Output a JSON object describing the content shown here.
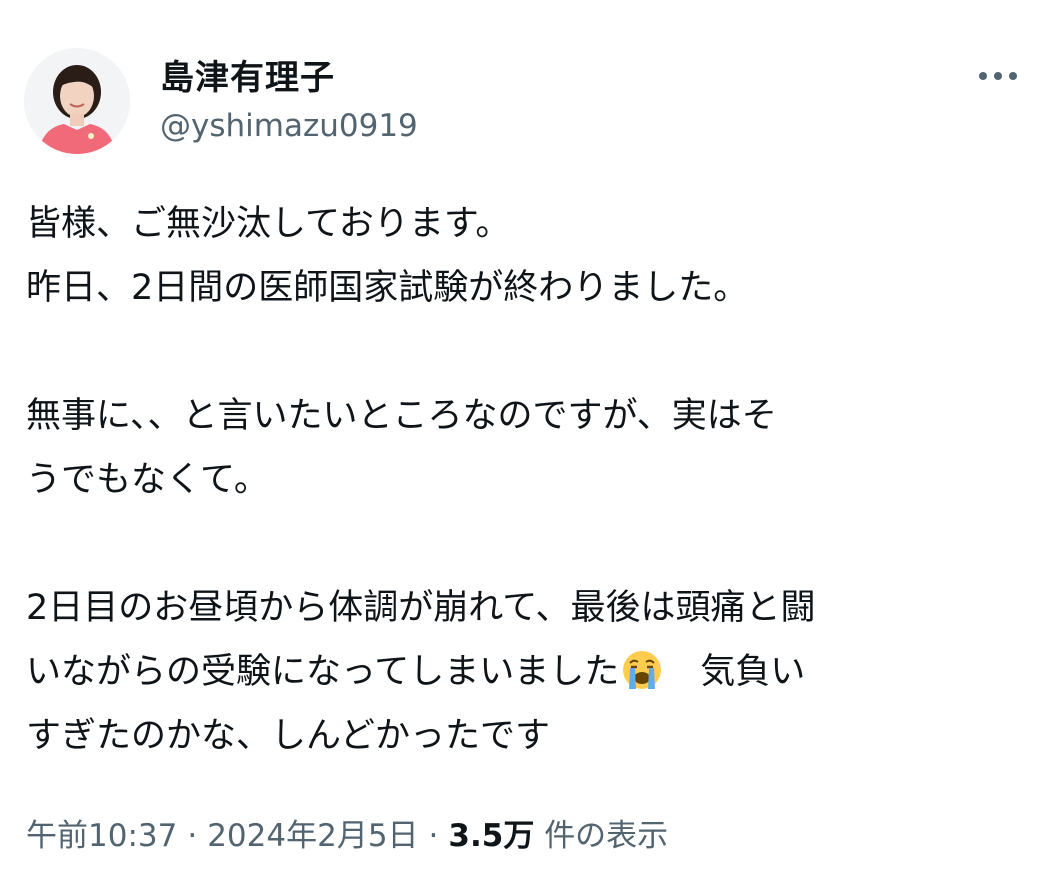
{
  "author": {
    "display_name": "島津有理子",
    "handle": "@yshimazu0919",
    "avatar_icon": "profile-photo"
  },
  "more_menu_icon": "more-horizontal-icon",
  "tweet": {
    "lines": [
      "皆様、ご無沙汰しております。",
      "昨日、2日間の医師国家試験が終わりました。",
      "",
      "無事に、、と言いたいところなのですが、実はそ",
      "うでもなくて。",
      "",
      "2日目のお昼頃から体調が崩れて、最後は頭痛と闘",
      "いながらの受験になってしまいました",
      "すぎたのかな、しんどかったです"
    ],
    "emoji": "loudly-crying-face-emoji",
    "after_emoji": "　気負い"
  },
  "meta": {
    "time": "午前10:37",
    "date": "2024年2月5日",
    "separator": "·",
    "views_count": "3.5万",
    "views_label": "件の表示"
  },
  "colors": {
    "text": "#0f1419",
    "secondary": "#536471",
    "background": "#ffffff"
  }
}
